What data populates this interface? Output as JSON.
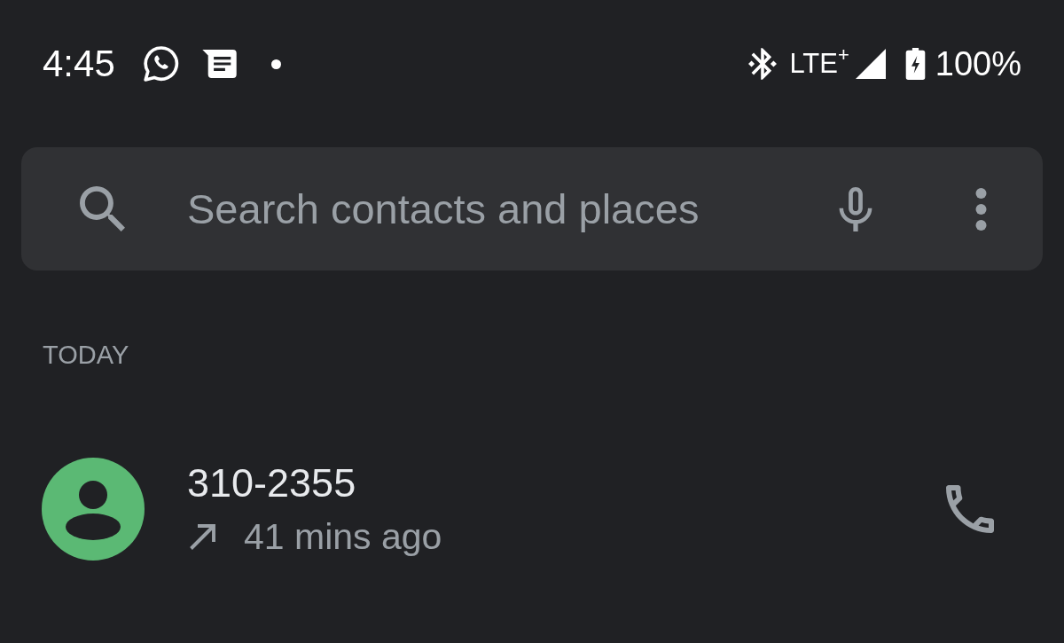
{
  "status_bar": {
    "time": "4:45",
    "network": "LTE$^{+}$",
    "battery": "100%"
  },
  "search": {
    "placeholder": "Search contacts and places"
  },
  "call_log": {
    "sections": [
      {
        "heading": "TODAY",
        "calls": [
          {
            "number": "310-2355",
            "outgoing": true,
            "time": "41 mins ago",
            "color": "#5bb974"
          }
        ]
      }
    ]
  }
}
